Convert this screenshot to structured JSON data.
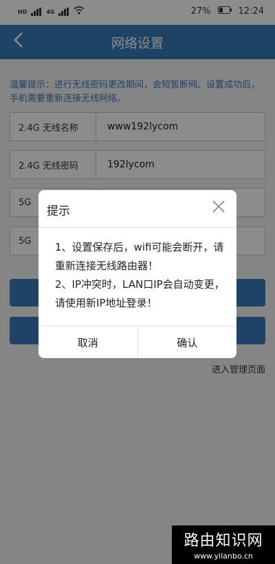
{
  "status_bar": {
    "battery": "27%",
    "time": "12:24",
    "net1": "HD",
    "net2": "4G"
  },
  "header": {
    "title": "网络设置"
  },
  "tip": "温馨提示：进行无线密码更改期间，会短暂断网。设置成功后，手机需要重新连接无线网络。",
  "fields": [
    {
      "label": "2.4G 无线名称",
      "value": "www192lycom"
    },
    {
      "label": "2.4G 无线密码",
      "value": "192lycom"
    },
    {
      "label": "5G",
      "value": ""
    },
    {
      "label": "5G",
      "value": ""
    }
  ],
  "manage_link": "进入管理页面",
  "dialog": {
    "title": "提示",
    "line1": "1、设置保存后，wifi可能会断开，请重新连接无线路由器！",
    "line2": "2、IP冲突时，LAN口IP会自动变更，请使用新IP地址登录！",
    "cancel": "取消",
    "confirm": "确认"
  },
  "watermark": {
    "name": "路由知识网",
    "url": "www.yilanbo.cn"
  },
  "colors": {
    "accent": "#3a7ab8"
  }
}
